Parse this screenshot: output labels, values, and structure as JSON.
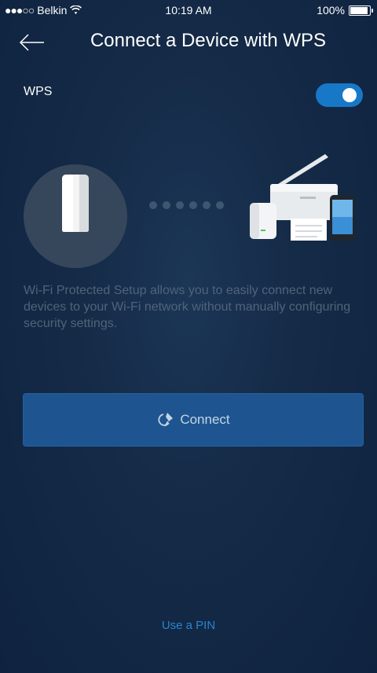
{
  "status_bar": {
    "carrier": "Belkin",
    "time": "10:19 AM",
    "battery_percent": "100%",
    "battery_level": 1.0
  },
  "header": {
    "title": "Connect a Device with WPS"
  },
  "wps": {
    "label": "WPS",
    "enabled": true
  },
  "description": "Wi-Fi Protected Setup allows you to easily connect new devices to your Wi-Fi network without manually configuring security settings.",
  "connect_button": {
    "label": "Connect"
  },
  "pin_link": {
    "label": "Use a PIN"
  },
  "colors": {
    "background": "#142a46",
    "accent": "#1778c8",
    "button": "#1e5590",
    "link": "#2b84d0",
    "muted_text": "#50637a"
  }
}
